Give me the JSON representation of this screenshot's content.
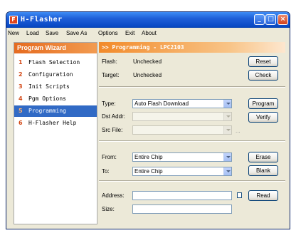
{
  "window": {
    "title": "H-Flasher",
    "app_icon_glyph": "F",
    "controls": {
      "minimize": "_",
      "maximize": "□",
      "close": "×"
    }
  },
  "menu": [
    "New",
    "Load",
    "Save",
    "Save As",
    "Options",
    "Exit",
    "About"
  ],
  "wizard": {
    "header": "Program Wizard",
    "items": [
      {
        "num": "1",
        "label": "Flash Selection"
      },
      {
        "num": "2",
        "label": "Configuration"
      },
      {
        "num": "3",
        "label": "Init Scripts"
      },
      {
        "num": "4",
        "label": "Pgm Options"
      },
      {
        "num": "5",
        "label": "Programming",
        "active": true
      },
      {
        "num": "6",
        "label": "H-Flasher Help"
      }
    ]
  },
  "programming": {
    "header": ">> Programming - LPC2103",
    "flash_label": "Flash:",
    "flash_value": "Unchecked",
    "target_label": "Target:",
    "target_value": "Unchecked",
    "reset_button": "Reset",
    "check_button": "Check",
    "type_label": "Type:",
    "type_value": "Auto Flash Download",
    "dst_addr_label": "Dst Addr:",
    "dst_addr_value": "",
    "src_file_label": "Src File:",
    "src_file_value": "",
    "browse_ellipsis": "...",
    "program_button": "Program",
    "verify_button": "Verify",
    "from_label": "From:",
    "from_value": "Entire Chip",
    "to_label": "To:",
    "to_value": "Entire Chip",
    "erase_button": "Erase",
    "blank_button": "Blank",
    "address_label": "Address:",
    "address_value": "",
    "size_label": "Size:",
    "size_value": "",
    "read_button": "Read"
  }
}
